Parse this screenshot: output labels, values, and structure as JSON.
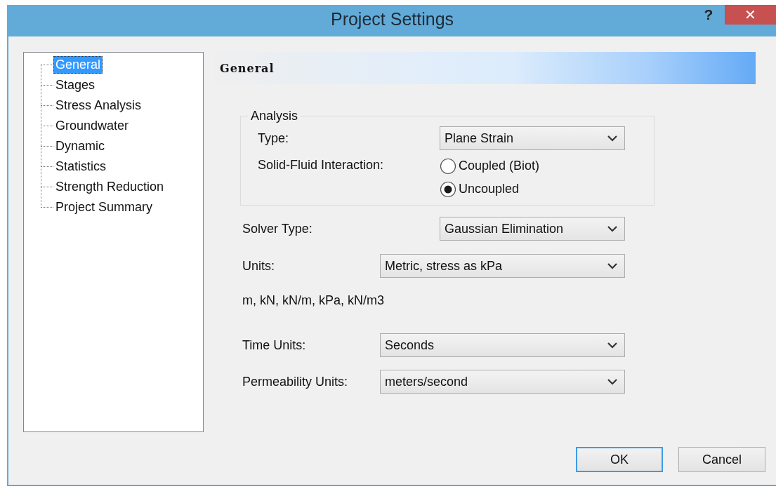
{
  "window": {
    "title": "Project Settings",
    "help": "?",
    "close": "✕"
  },
  "tree": {
    "items": [
      {
        "label": "General",
        "selected": true
      },
      {
        "label": "Stages",
        "selected": false
      },
      {
        "label": "Stress Analysis",
        "selected": false
      },
      {
        "label": "Groundwater",
        "selected": false
      },
      {
        "label": "Dynamic",
        "selected": false
      },
      {
        "label": "Statistics",
        "selected": false
      },
      {
        "label": "Strength Reduction",
        "selected": false
      },
      {
        "label": "Project Summary",
        "selected": false
      }
    ]
  },
  "header": "General",
  "analysis": {
    "legend": "Analysis",
    "type_label": "Type:",
    "type_value": "Plane Strain",
    "interaction_label": "Solid-Fluid Interaction:",
    "options": [
      {
        "label": "Coupled (Biot)",
        "selected": false
      },
      {
        "label": "Uncoupled",
        "selected": true
      }
    ]
  },
  "solver": {
    "label": "Solver Type:",
    "value": "Gaussian Elimination"
  },
  "units": {
    "label": "Units:",
    "value": "Metric, stress as kPa"
  },
  "units_summary": "m, kN, kN/m, kPa, kN/m3",
  "time_units": {
    "label": "Time Units:",
    "value": "Seconds"
  },
  "permeability_units": {
    "label": "Permeability Units:",
    "value": "meters/second"
  },
  "buttons": [
    {
      "label": "OK",
      "default": true
    },
    {
      "label": "Cancel",
      "default": false
    }
  ]
}
